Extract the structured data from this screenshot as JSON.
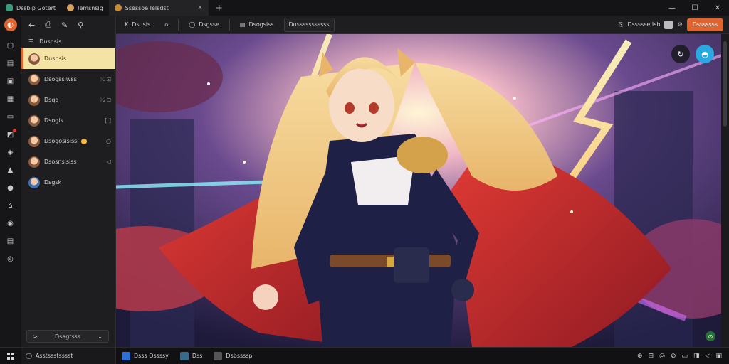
{
  "tabs": [
    {
      "title": "Dssbip Gotert",
      "icon": "app-icon",
      "active": false
    },
    {
      "title": "Iemsnsig",
      "icon": "avatar-icon",
      "active": false
    },
    {
      "title": "Ssessoe Ielsdst",
      "icon": "globe-icon",
      "active": true,
      "close": "×"
    }
  ],
  "window": {
    "minimize": "—",
    "maximize": "☐",
    "close": "✕",
    "new_tab": "+"
  },
  "rail": {
    "logo": "◐",
    "icons": [
      "▢",
      "▤",
      "▣",
      "▦",
      "▭",
      "◩",
      "◈",
      "▲",
      "●",
      "⌂",
      "◉",
      "▤",
      "◎"
    ]
  },
  "sidebar": {
    "tools": [
      "←",
      "⎙",
      "✎",
      "⚲"
    ],
    "header": "Dusnsis",
    "items": [
      {
        "label": "Dusnsis",
        "meta": "",
        "active": true
      },
      {
        "label": "Dsogssiwss",
        "meta": "⤯ ⊡",
        "active": false
      },
      {
        "label": "Dsqq",
        "meta": "⤯ ⊡",
        "active": false
      },
      {
        "label": "Dsogis",
        "meta": "[ ]",
        "active": false
      },
      {
        "label": "Dsogosisiss",
        "meta": "○",
        "emoji": true,
        "active": false
      },
      {
        "label": "Dsosnsisiss",
        "meta": "◁",
        "active": false
      },
      {
        "label": "Dsgsk",
        "meta": "",
        "active": false
      }
    ],
    "footer": {
      "label": "Dsagtsss",
      "left": ">",
      "right": "⌄"
    }
  },
  "toolbar": {
    "back": "K",
    "back_label": "Dsusis",
    "home": "⌂",
    "search_icon": "◯",
    "search_label": "Dsgsse",
    "doc_label": "Dsogsiss",
    "active_label": "Dusssssssssss",
    "right_label": "Dssssse Isb",
    "primary": "Dsssssss"
  },
  "taskbar": {
    "search": "Asstssstsssst",
    "apps": [
      {
        "label": "Dsss Ossssy",
        "color": "#2f6fd6"
      },
      {
        "label": "Dss",
        "color": "#3a6a8a"
      },
      {
        "label": "Dsbssssp",
        "color": "#555"
      }
    ],
    "tray": [
      "⊕",
      "⊟",
      "◎",
      "⊘",
      "▭",
      "◨",
      "◁",
      "▣"
    ]
  },
  "canvas": {
    "fab_left": "↻",
    "fab_right": "◓",
    "fab_small": "⊙"
  },
  "colors": {
    "accent": "#e0642f",
    "active_item": "#f3e3a4",
    "cyan": "#2aa8e0"
  }
}
